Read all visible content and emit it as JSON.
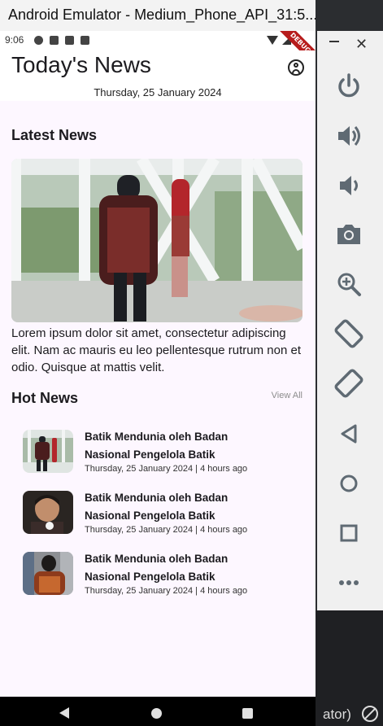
{
  "window": {
    "title": "Android Emulator - Medium_Phone_API_31:5..."
  },
  "status_bar": {
    "time": "9:06",
    "debug_banner": "DEBUG"
  },
  "app": {
    "title": "Today's News",
    "date": "Thursday, 25 January 2024",
    "latest_heading": "Latest News",
    "latest_description": "Lorem ipsum dolor sit amet, consectetur adipiscing elit. Nam ac mauris eu leo pellentesque rutrum non et odio. Quisque at mattis velit.",
    "hot_heading": "Hot News",
    "view_all": "View All",
    "hot_items": [
      {
        "title": "Batik Mendunia oleh Badan Nasional Pengelola Batik",
        "meta": "Thursday, 25 January 2024 | 4 hours ago"
      },
      {
        "title": "Batik Mendunia oleh Badan Nasional Pengelola Batik",
        "meta": "Thursday, 25 January 2024 | 4 hours ago"
      },
      {
        "title": "Batik Mendunia oleh Badan Nasional Pengelola Batik",
        "meta": "Thursday, 25 January 2024 | 4 hours ago"
      }
    ]
  },
  "emulator_toolbar": {
    "buttons": [
      "power-icon",
      "volume-up-icon",
      "volume-down-icon",
      "camera-icon",
      "zoom-icon",
      "rotate-left-icon",
      "rotate-right-icon",
      "back-icon",
      "home-icon",
      "overview-icon",
      "more-icon"
    ],
    "icon_color": "#5f6a73"
  },
  "bottom_label": "ator)"
}
